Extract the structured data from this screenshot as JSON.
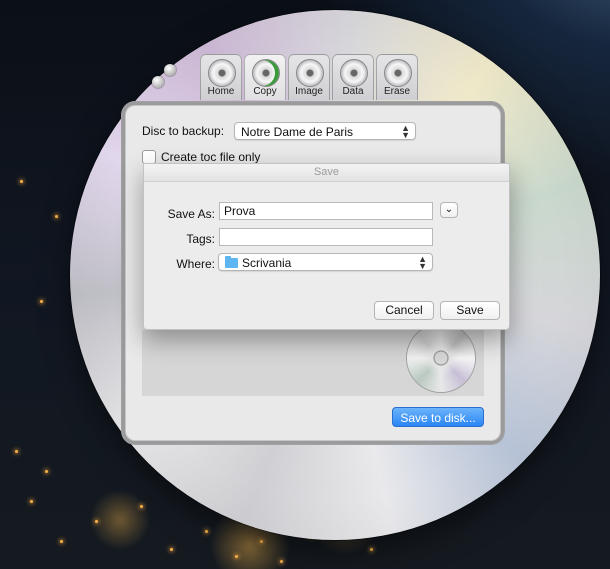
{
  "app": {
    "tabs": [
      {
        "label": "Home"
      },
      {
        "label": "Copy"
      },
      {
        "label": "Image"
      },
      {
        "label": "Data"
      },
      {
        "label": "Erase"
      }
    ],
    "active_tab": "Copy"
  },
  "copy_panel": {
    "disc_label": "Disc to backup:",
    "disc_value": "Notre Dame de Paris",
    "toc_checkbox_label": "Create toc file only",
    "toc_checked": false,
    "save_to_disk_label": "Save to disk..."
  },
  "save_sheet": {
    "title": "Save",
    "save_as_label": "Save As:",
    "save_as_value": "Prova",
    "tags_label": "Tags:",
    "tags_value": "",
    "where_label": "Where:",
    "where_value": "Scrivania",
    "cancel_label": "Cancel",
    "save_label": "Save"
  },
  "colors": {
    "accent_blue": "#2a86f4",
    "folder_blue": "#5db6f2"
  }
}
